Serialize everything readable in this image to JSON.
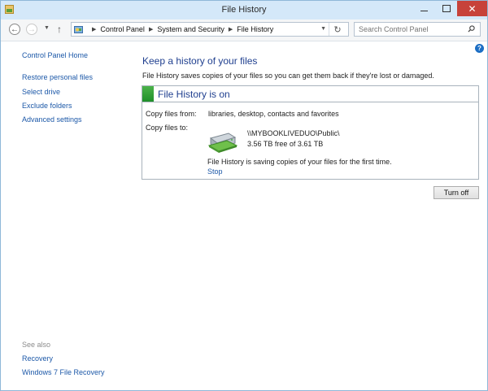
{
  "window": {
    "title": "File History",
    "minimize_glyph": "",
    "close_glyph": "✕"
  },
  "nav": {
    "back_glyph": "←",
    "forward_glyph": "→",
    "up_glyph": "↑",
    "breadcrumbs": [
      "Control Panel",
      "System and Security",
      "File History"
    ],
    "search_placeholder": "Search Control Panel",
    "refresh_glyph": "↻"
  },
  "help_glyph": "?",
  "sidebar": {
    "home": "Control Panel Home",
    "items": [
      "Restore personal files",
      "Select drive",
      "Exclude folders",
      "Advanced settings"
    ],
    "see_also_label": "See also",
    "see_also": [
      "Recovery",
      "Windows 7 File Recovery"
    ]
  },
  "main": {
    "heading": "Keep a history of your files",
    "description": "File History saves copies of your files so you can get them back if they're lost or damaged.",
    "status": {
      "title": "File History is on",
      "color": "#2e9e37"
    },
    "copy_from_label": "Copy files from:",
    "copy_from_value": "libraries, desktop, contacts and favorites",
    "copy_to_label": "Copy files to:",
    "drive": {
      "name": "\\\\MYBOOKLIVEDUO\\Public\\",
      "free": "3.56 TB free of 3.61 TB"
    },
    "saving_message": "File History is saving copies of your files for the first time.",
    "stop_link": "Stop",
    "turn_off_button": "Turn off"
  },
  "colors": {
    "link": "#1c58a8",
    "heading": "#1f3f8f",
    "close_button": "#c7423a",
    "titlebar": "#d4e8f9"
  }
}
